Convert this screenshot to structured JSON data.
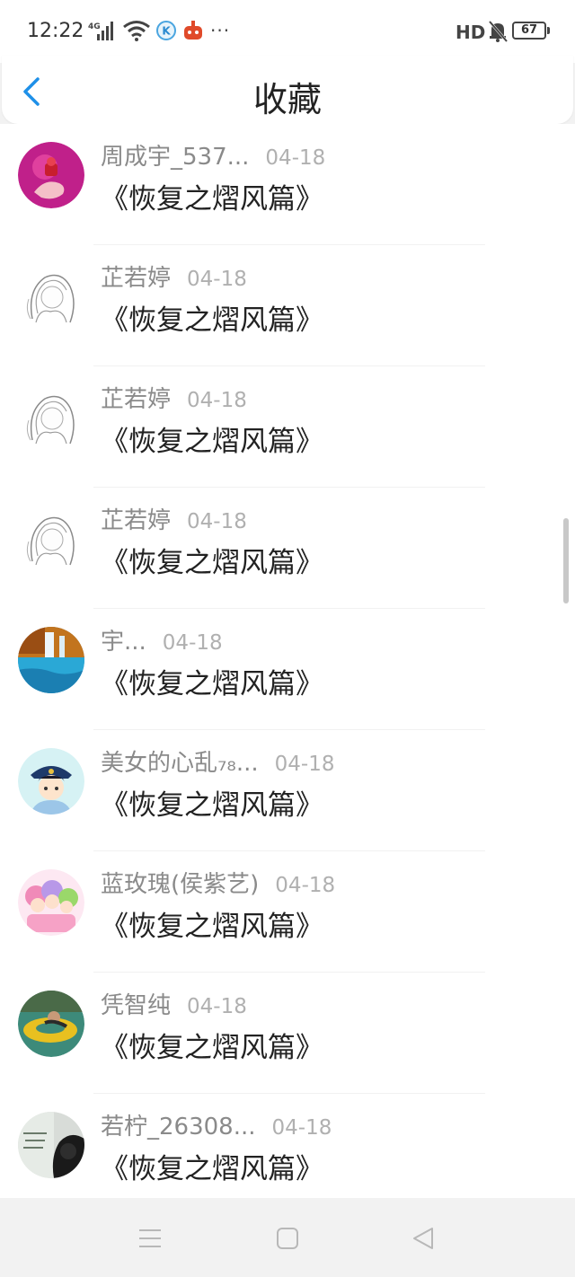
{
  "status_bar": {
    "time": "12:22",
    "network": "4G",
    "more": "···",
    "hd": "HD",
    "battery": "67"
  },
  "header": {
    "title": "收藏"
  },
  "items": [
    {
      "user": "周成宇_537...",
      "date": "04-18",
      "post": "《恢复之熠风篇》",
      "avatar_icon": "avatar-pink-hand-icon"
    },
    {
      "user": "芷若婷",
      "date": "04-18",
      "post": "《恢复之熠风篇》",
      "avatar_icon": "avatar-sketch-girl-icon"
    },
    {
      "user": "芷若婷",
      "date": "04-18",
      "post": "《恢复之熠风篇》",
      "avatar_icon": "avatar-sketch-girl-icon"
    },
    {
      "user": "芷若婷",
      "date": "04-18",
      "post": "《恢复之熠风篇》",
      "avatar_icon": "avatar-sketch-girl-icon"
    },
    {
      "user": "宇...",
      "date": "04-18",
      "post": "《恢复之熠风篇》",
      "avatar_icon": "avatar-waterfall-icon"
    },
    {
      "user": "美女的心乱₇₈...",
      "date": "04-18",
      "post": "《恢复之熠风篇》",
      "avatar_icon": "avatar-cartoon-officer-icon"
    },
    {
      "user": "蓝玫瑰(侯紫艺)",
      "date": "04-18",
      "post": "《恢复之熠风篇》",
      "avatar_icon": "avatar-cartoon-girls-icon"
    },
    {
      "user": "凭智纯",
      "date": "04-18",
      "post": "《恢复之熠风篇》",
      "avatar_icon": "avatar-swim-ring-icon"
    },
    {
      "user": "若柠_26308...",
      "date": "04-18",
      "post": "《恢复之熠风篇》",
      "avatar_icon": "avatar-headphones-girl-icon"
    }
  ],
  "colors": {
    "accent": "#1e90e8",
    "username": "#8a8a8a",
    "date": "#b0b0b0",
    "post": "#222222"
  }
}
